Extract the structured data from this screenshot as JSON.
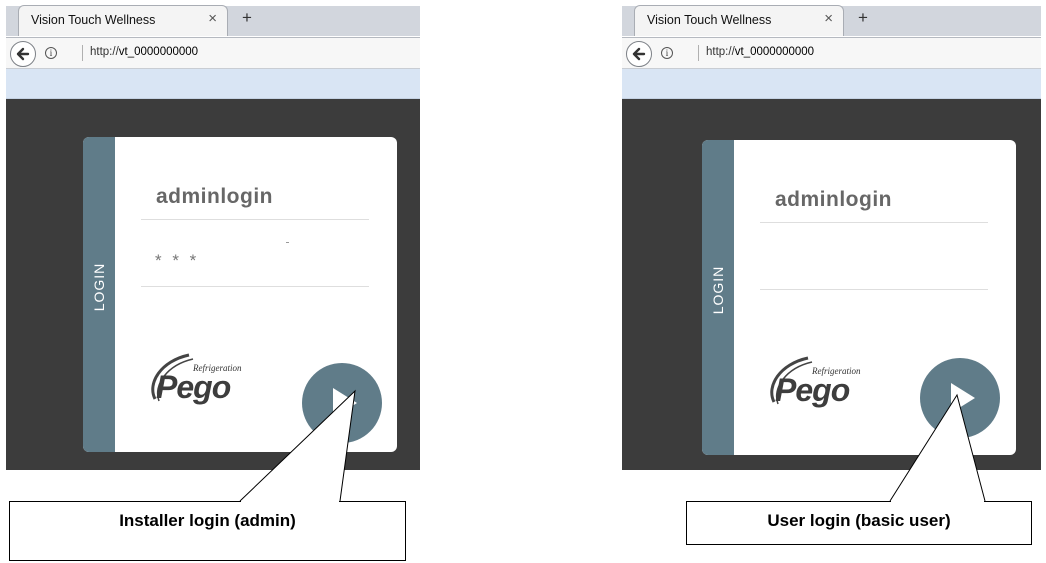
{
  "screens": [
    {
      "tab_title": "Vision Touch Wellness",
      "tab_close": "×",
      "new_tab": "+",
      "url_prefix": "http://",
      "url_host": "vt_0000000000",
      "login_label": "LOGIN",
      "username": "adminlogin",
      "password_mask": "* * *",
      "brand_tagline": "Refrigeration",
      "brand_name": "Pego"
    },
    {
      "tab_title": "Vision Touch  Wellness",
      "tab_close": "×",
      "new_tab": "+",
      "url_prefix": "http://",
      "url_host": "vt_0000000000",
      "login_label": "LOGIN",
      "username": "adminlogin",
      "password_mask": "",
      "brand_tagline": "Refrigeration",
      "brand_name": "Pego"
    }
  ],
  "callouts": [
    {
      "text": "Installer login (admin)"
    },
    {
      "text": "User login (basic user)"
    }
  ],
  "colors": {
    "accent": "#607c89",
    "dark_background": "#3c3c3c",
    "info_bar": "#d9e5f4"
  },
  "icons": {
    "back": "back-arrow-icon",
    "info": "info-icon",
    "submit": "play-arrow-icon"
  }
}
